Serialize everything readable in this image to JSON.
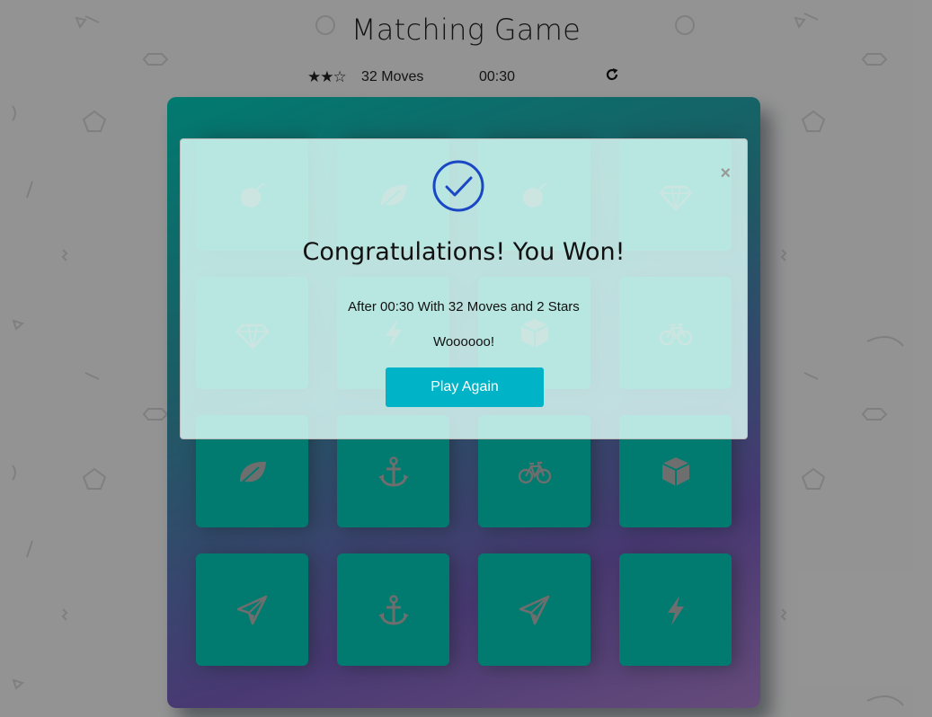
{
  "game": {
    "title": "Matching Game",
    "moves_label": "32 Moves",
    "timer": "00:30",
    "stars_rating": 2,
    "stars_max": 3
  },
  "cards": [
    {
      "icon": "bomb-icon",
      "state": "match"
    },
    {
      "icon": "leaf-icon",
      "state": "match"
    },
    {
      "icon": "bomb-icon",
      "state": "match"
    },
    {
      "icon": "diamond-icon",
      "state": "match"
    },
    {
      "icon": "diamond-icon",
      "state": "match"
    },
    {
      "icon": "bolt-icon",
      "state": "match"
    },
    {
      "icon": "cube-icon",
      "state": "match"
    },
    {
      "icon": "bicycle-icon",
      "state": "match"
    },
    {
      "icon": "leaf-icon",
      "state": "match"
    },
    {
      "icon": "anchor-icon",
      "state": "match"
    },
    {
      "icon": "bicycle-icon",
      "state": "match"
    },
    {
      "icon": "cube-icon",
      "state": "match"
    },
    {
      "icon": "paper-plane-icon",
      "state": "match"
    },
    {
      "icon": "anchor-icon",
      "state": "match"
    },
    {
      "icon": "paper-plane-icon",
      "state": "match"
    },
    {
      "icon": "bolt-icon",
      "state": "match"
    }
  ],
  "modal": {
    "heading": "Congratulations! You Won!",
    "stats_text": "After 00:30 With 32 Moves and 2 Stars",
    "message": "Woooooo!",
    "button_label": "Play Again",
    "close_symbol": "×"
  },
  "colors": {
    "card_match": "#02ccba",
    "button": "#00b3c6",
    "check": "#1a47c4"
  }
}
